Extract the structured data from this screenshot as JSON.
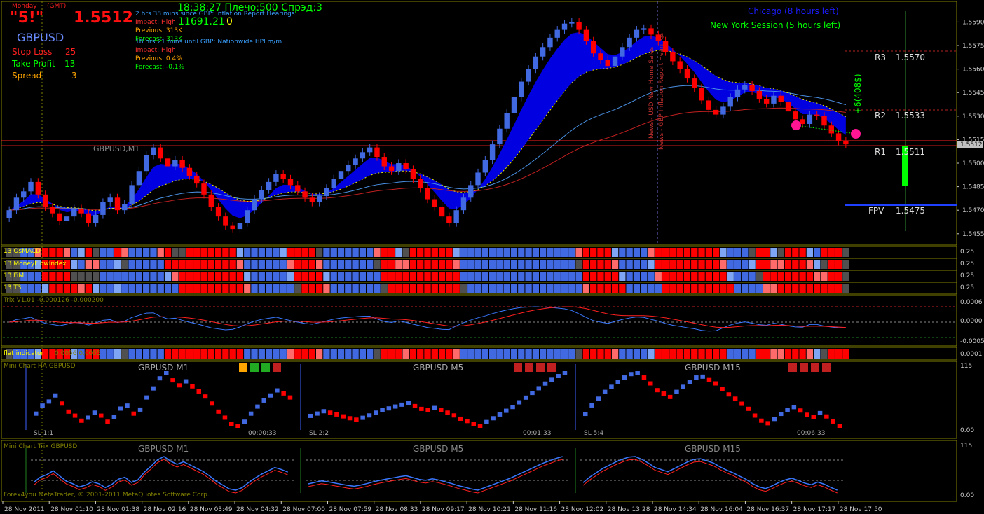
{
  "colors": {
    "bull": "#4169e1",
    "bear": "#ff0000",
    "bullHist": "#4169e1",
    "bullLight": "#7fa6f5",
    "bearHist": "#ff0000",
    "bearLight": "#ff6a6a",
    "neutral": "#505050",
    "bg": "#000000",
    "grid": "#808000",
    "cloud": "#0000e0",
    "accentGreen": "#00ff00",
    "accentYellow": "#ffff00"
  },
  "top_left": {
    "day": "Monday",
    "tz": "(GMT)",
    "signal": "\"5!\"",
    "price": "1.5512",
    "symbol": "GBPUSD",
    "stop_loss_label": "Stop Loss",
    "stop_loss_value": "25",
    "take_profit_label": "Take Profit",
    "take_profit_value": "13",
    "spread_label": "Spread",
    "spread_value": "3"
  },
  "news": {
    "lines": [
      "2 hrs 38 mins since GBP: Inflation Report Hearings",
      "Impact: High",
      "Previous: 313K",
      "Forecast: 313K",
      "18 hrs 21 mins until GBP: Nationwide HPI m/m",
      "Impact: High",
      "Previous: 0.4%",
      "Forecast: -0.1%"
    ],
    "clock": "18:38:27 Плечо:500 Спрэд:3",
    "balance": "11691.21",
    "balance_extra": "0"
  },
  "sessions": {
    "chicago": "Chicago (8 hours left)",
    "newyork": "New York Session (5 hours left)"
  },
  "pivots": {
    "r3_label": "R3",
    "r3": "1.5570",
    "r2_label": "R2",
    "r2": "1.5533",
    "r1_label": "R1",
    "r1": "1.5511",
    "fpv_label": "FPV",
    "fpv": "1.5475"
  },
  "annotations": {
    "profit": "+6(408$)",
    "news_vertical1": "News - USD New Home Sales",
    "news_vertical2": "News - GBP Inflation Report Hearings",
    "symbol_watermark": "GBPUSD,M1"
  },
  "panels": {
    "osmacd": "13 OsMACD",
    "mfi": "13 MoneyFlowIndex",
    "fim": "13 FiM",
    "t3": "13 T3",
    "trix": "Trix V1.01 -0.000126 -0.000200",
    "flat": "flat indicator",
    "flat_value": "0.0056 0.0055",
    "mini_ha": "Mini Chart HA GBPUSD",
    "mini_trix": "Mini Chart Trix GBPUSD",
    "copyright": "Forex4you MetaTrader, © 2001-2011 MetaQuotes Software Corp."
  },
  "mini": {
    "titles": [
      "GBPUSD M1",
      "GBPUSD M5",
      "GBPUSD M15"
    ],
    "sl": [
      "SL 1:1",
      "SL 2:2",
      "SL 5:4"
    ],
    "timers": [
      "00:00:33",
      "00:01:33",
      "00:06:33"
    ]
  },
  "axis_labels": {
    "trix": [
      "0.0006",
      "0.0000",
      "-0.0005"
    ],
    "flat": "0.0001",
    "mini_ha": [
      "115",
      "0.00"
    ],
    "mini_trix": [
      "115",
      "0.00"
    ],
    "hist": [
      "0.25",
      "0.25",
      "0.25",
      "0.25"
    ]
  },
  "chart_data": {
    "type": "candlestick",
    "symbol": "GBPUSD",
    "timeframe": "M1",
    "current_price": 1.5512,
    "price_ticks": [
      1.559,
      1.5575,
      1.556,
      1.5545,
      1.553,
      1.5515,
      1.55,
      1.5485,
      1.547,
      1.5455
    ],
    "ylim": [
      1.545,
      1.5596
    ],
    "x_ticks": [
      "28 Nov 2011",
      "28 Nov 01:10",
      "28 Nov 01:38",
      "28 Nov 02:16",
      "28 Nov 03:49",
      "28 Nov 04:32",
      "28 Nov 07:00",
      "28 Nov 07:59",
      "28 Nov 08:33",
      "28 Nov 09:17",
      "28 Nov 10:21",
      "28 Nov 11:16",
      "28 Nov 12:02",
      "28 Nov 13:28",
      "28 Nov 14:34",
      "28 Nov 16:04",
      "28 Nov 16:37",
      "28 Nov 17:17",
      "28 Nov 17:50"
    ],
    "closes": [
      1.547,
      1.5478,
      1.5482,
      1.5488,
      1.548,
      1.5472,
      1.5468,
      1.5463,
      1.5466,
      1.5471,
      1.5468,
      1.5462,
      1.5467,
      1.5475,
      1.5478,
      1.547,
      1.5474,
      1.5486,
      1.5495,
      1.5505,
      1.551,
      1.5503,
      1.5498,
      1.5502,
      1.5497,
      1.5492,
      1.5487,
      1.548,
      1.5472,
      1.5466,
      1.546,
      1.5458,
      1.5462,
      1.547,
      1.5477,
      1.5483,
      1.5488,
      1.5493,
      1.549,
      1.5486,
      1.5482,
      1.5478,
      1.5475,
      1.5479,
      1.5484,
      1.549,
      1.5495,
      1.5499,
      1.5503,
      1.5507,
      1.551,
      1.5504,
      1.5498,
      1.5495,
      1.55,
      1.5496,
      1.549,
      1.5484,
      1.5477,
      1.5472,
      1.5466,
      1.5462,
      1.547,
      1.5478,
      1.5486,
      1.5494,
      1.5502,
      1.5512,
      1.5522,
      1.5532,
      1.5542,
      1.5552,
      1.556,
      1.5568,
      1.5574,
      1.558,
      1.5585,
      1.5589,
      1.559,
      1.5585,
      1.5578,
      1.557,
      1.5566,
      1.5562,
      1.5568,
      1.5574,
      1.558,
      1.5585,
      1.5586,
      1.5582,
      1.5578,
      1.5571,
      1.5565,
      1.556,
      1.5554,
      1.5548,
      1.554,
      1.5534,
      1.5531,
      1.5536,
      1.5542,
      1.5547,
      1.555,
      1.5546,
      1.5541,
      1.5538,
      1.5543,
      1.5539,
      1.5533,
      1.5528,
      1.5525,
      1.5531,
      1.553,
      1.5524,
      1.5519,
      1.5514,
      1.5512
    ],
    "dir": [
      1,
      1,
      1,
      1,
      -1,
      -1,
      -1,
      -1,
      1,
      1,
      -1,
      -1,
      1,
      1,
      1,
      -1,
      1,
      1,
      1,
      1,
      1,
      -1,
      -1,
      1,
      -1,
      -1,
      -1,
      -1,
      -1,
      -1,
      -1,
      -1,
      1,
      1,
      1,
      1,
      1,
      1,
      -1,
      -1,
      -1,
      -1,
      -1,
      1,
      1,
      1,
      1,
      1,
      1,
      1,
      1,
      -1,
      -1,
      -1,
      1,
      -1,
      -1,
      -1,
      -1,
      -1,
      -1,
      -1,
      1,
      1,
      1,
      1,
      1,
      1,
      1,
      1,
      1,
      1,
      1,
      1,
      1,
      1,
      1,
      1,
      1,
      -1,
      -1,
      -1,
      -1,
      -1,
      1,
      1,
      1,
      1,
      1,
      -1,
      -1,
      -1,
      -1,
      -1,
      -1,
      -1,
      -1,
      -1,
      -1,
      1,
      1,
      1,
      1,
      -1,
      -1,
      -1,
      1,
      -1,
      -1,
      -1,
      -1,
      1,
      -1,
      -1,
      -1,
      -1,
      -1
    ]
  }
}
